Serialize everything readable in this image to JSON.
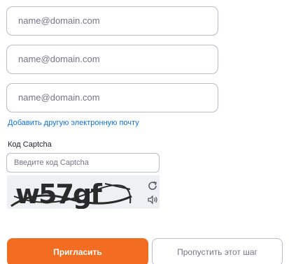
{
  "emails": [
    {
      "placeholder": "name@domain.com",
      "value": ""
    },
    {
      "placeholder": "name@domain.com",
      "value": ""
    },
    {
      "placeholder": "name@domain.com",
      "value": ""
    }
  ],
  "add_email_link": "Добавить другую электронную почту",
  "captcha": {
    "label": "Код Captcha",
    "placeholder": "Введите код Captcha",
    "value": "",
    "image_text": "w57gf",
    "refresh_icon": "refresh-icon",
    "audio_icon": "speaker-icon"
  },
  "buttons": {
    "invite": "Пригласить",
    "skip": "Пропустить этот шаг"
  },
  "colors": {
    "accent": "#f26d21",
    "link": "#0e72ed",
    "border": "#babacc",
    "placeholder": "#747487"
  }
}
